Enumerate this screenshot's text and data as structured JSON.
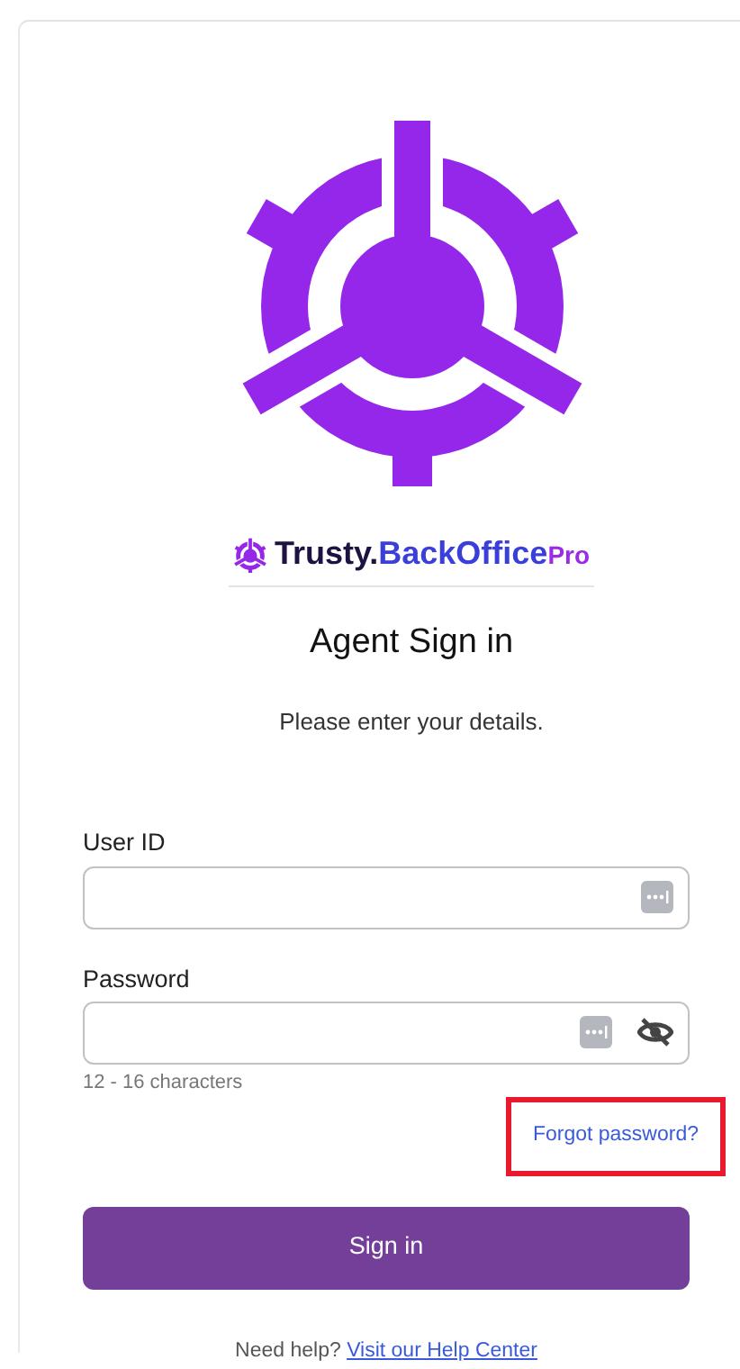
{
  "brand": {
    "name": "Trusty.",
    "product": "BackOffice",
    "edition": "Pro"
  },
  "heading": "Agent Sign in",
  "subtitle": "Please enter your details.",
  "fields": [
    {
      "label": "User ID",
      "kind": "text"
    },
    {
      "label": "Password",
      "kind": "password",
      "hint": "12 - 16 characters"
    }
  ],
  "forgot_link": {
    "text": "Forgot password?",
    "highlighted": true
  },
  "submit": "Sign in",
  "help": {
    "text": "Need help?",
    "link": "Visit our Help Center"
  }
}
